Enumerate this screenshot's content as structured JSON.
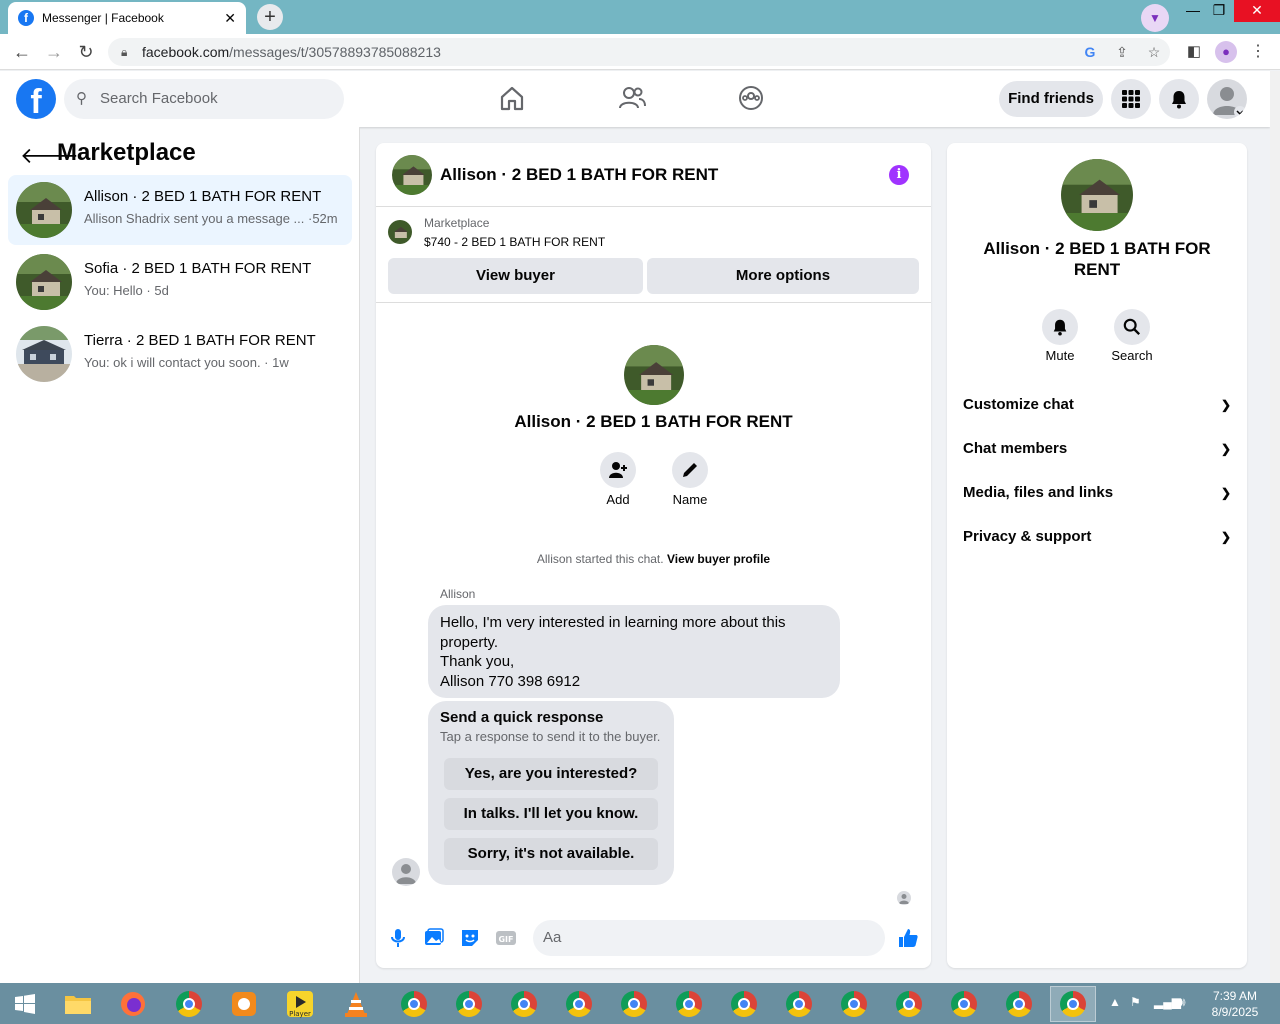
{
  "browser": {
    "tab_title": "Messenger | Facebook",
    "tab_close": "✕",
    "new_tab": "+",
    "url_domain": "facebook.com",
    "url_path": "/messages/t/30578893785088213"
  },
  "header": {
    "search_placeholder": "Search Facebook",
    "find_friends": "Find friends"
  },
  "sidebar": {
    "title": "Marketplace",
    "conversations": [
      {
        "name": "Allison · 2 BED 1 BATH FOR RENT",
        "snippet": "Allison Shadrix sent you a message ... ·52m"
      },
      {
        "name": "Sofia · 2 BED 1 BATH FOR RENT",
        "snippet": "You: Hello · 5d"
      },
      {
        "name": "Tierra · 2 BED 1 BATH FOR RENT",
        "snippet": "You: ok i will contact you soon. · 1w"
      }
    ]
  },
  "chat": {
    "title": "Allison · 2 BED 1 BATH FOR RENT",
    "marketplace_label": "Marketplace",
    "listing": "$740 - 2 BED 1 BATH FOR RENT",
    "view_buyer": "View buyer",
    "more_options": "More options",
    "intro_title": "Allison · 2 BED 1 BATH FOR RENT",
    "add_label": "Add",
    "name_label": "Name",
    "started_text": "Allison started this chat.",
    "started_link": "View buyer profile",
    "sender": "Allison",
    "message_lines": [
      "Hello, I'm very interested in learning more about this",
      "property.",
      "Thank you,",
      "Allison 770 398 6912"
    ],
    "quick_title": "Send a quick response",
    "quick_sub": "Tap a response to send it to the buyer.",
    "quick_responses": [
      "Yes, are you interested?",
      "In talks. I'll let you know.",
      "Sorry, it's not available."
    ],
    "input_placeholder": "Aa"
  },
  "details": {
    "title": "Allison · 2 BED 1 BATH FOR RENT",
    "mute": "Mute",
    "search": "Search",
    "sections": [
      "Customize chat",
      "Chat members",
      "Media, files and links",
      "Privacy & support"
    ]
  },
  "taskbar": {
    "time": "7:39 AM",
    "date": "8/9/2025",
    "player_label": "Player"
  },
  "colors": {
    "fb_blue": "#1877f2",
    "messenger_purple": "#a033ff",
    "active_row": "#ebf5ff"
  }
}
